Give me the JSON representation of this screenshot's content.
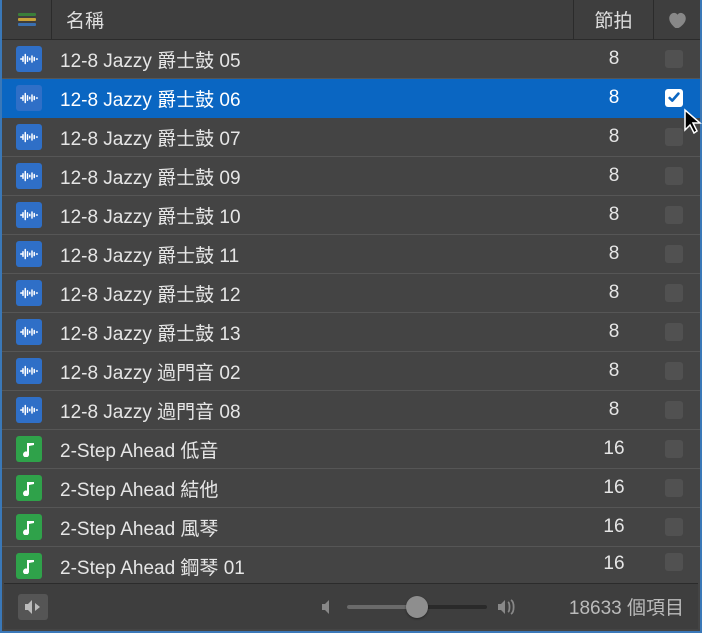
{
  "header": {
    "name_label": "名稱",
    "beats_label": "節拍"
  },
  "rows": [
    {
      "type": "audio",
      "name": "12-8 Jazzy 爵士鼓 05",
      "beats": "8",
      "fav": false,
      "selected": false
    },
    {
      "type": "audio",
      "name": "12-8 Jazzy 爵士鼓 06",
      "beats": "8",
      "fav": true,
      "selected": true
    },
    {
      "type": "audio",
      "name": "12-8 Jazzy 爵士鼓 07",
      "beats": "8",
      "fav": false,
      "selected": false
    },
    {
      "type": "audio",
      "name": "12-8 Jazzy 爵士鼓 09",
      "beats": "8",
      "fav": false,
      "selected": false
    },
    {
      "type": "audio",
      "name": "12-8 Jazzy 爵士鼓 10",
      "beats": "8",
      "fav": false,
      "selected": false
    },
    {
      "type": "audio",
      "name": "12-8 Jazzy 爵士鼓 11",
      "beats": "8",
      "fav": false,
      "selected": false
    },
    {
      "type": "audio",
      "name": "12-8 Jazzy 爵士鼓 12",
      "beats": "8",
      "fav": false,
      "selected": false
    },
    {
      "type": "audio",
      "name": "12-8 Jazzy 爵士鼓 13",
      "beats": "8",
      "fav": false,
      "selected": false
    },
    {
      "type": "audio",
      "name": "12-8 Jazzy 過門音 02",
      "beats": "8",
      "fav": false,
      "selected": false
    },
    {
      "type": "audio",
      "name": "12-8 Jazzy 過門音 08",
      "beats": "8",
      "fav": false,
      "selected": false
    },
    {
      "type": "midi",
      "name": "2-Step Ahead 低音",
      "beats": "16",
      "fav": false,
      "selected": false
    },
    {
      "type": "midi",
      "name": "2-Step Ahead 結他",
      "beats": "16",
      "fav": false,
      "selected": false
    },
    {
      "type": "midi",
      "name": "2-Step Ahead 風琴",
      "beats": "16",
      "fav": false,
      "selected": false
    },
    {
      "type": "midi",
      "name": "2-Step Ahead 鋼琴 01",
      "beats": "16",
      "fav": false,
      "selected": false,
      "cut": true
    }
  ],
  "footer": {
    "count_label": "18633 個項目",
    "volume_percent": 50
  }
}
